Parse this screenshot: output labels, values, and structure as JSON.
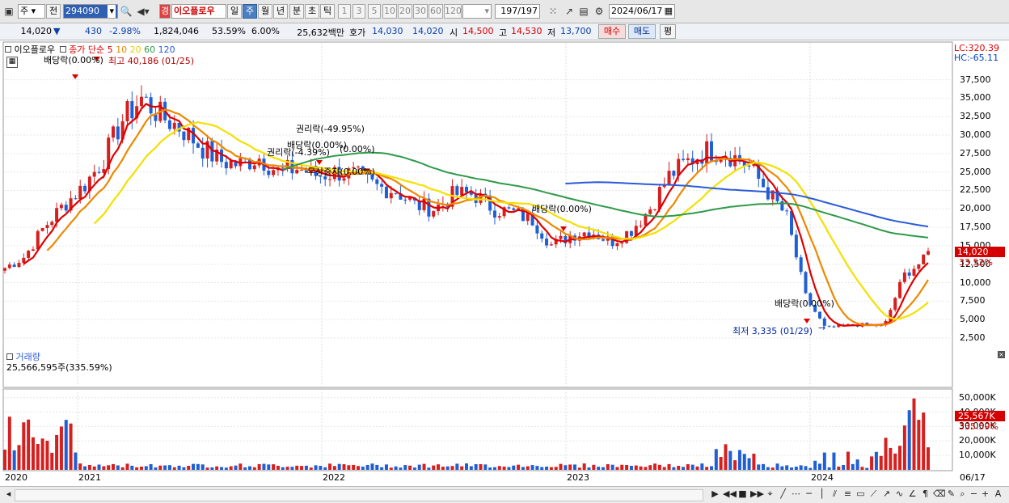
{
  "toolbar": {
    "period_short": "주",
    "prev_label": "전",
    "code": "294090",
    "stock_name": "이오플로우",
    "period_badge": "경",
    "periods": [
      "일",
      "주",
      "월",
      "년",
      "분",
      "초",
      "틱"
    ],
    "active_period": "주",
    "intervals": [
      "1",
      "3",
      "5",
      "10",
      "20",
      "30",
      "60",
      "120"
    ],
    "count": "197/197",
    "date": "2024/06/17"
  },
  "quote": {
    "price": "14,020",
    "change_arrow": "▼",
    "change": "430",
    "change_pct": "-2.98%",
    "volume": "1,824,046",
    "vol_ratio": "53.59%",
    "turnover": "6.00%",
    "amount": "25,632백만",
    "bid_label": "호가",
    "ask": "14,030",
    "bid": "14,020",
    "open_label": "시",
    "open": "14,500",
    "high_label": "고",
    "high": "14,530",
    "low_label": "저",
    "low": "13,700",
    "buy_btn": "매수",
    "sell_btn": "매도",
    "eval_btn": "평"
  },
  "legend": {
    "name": "이오플로우",
    "ma_label": "종가 단순",
    "ma_periods": [
      "5",
      "10",
      "20",
      "60",
      "120"
    ],
    "ma_colors": [
      "#dd0000",
      "#ee8800",
      "#f4e000",
      "#2f9a4a",
      "#2a5bd8"
    ]
  },
  "scale_info": {
    "lc": "LC:320.39",
    "hc": "HC:-65.11"
  },
  "price_axis": [
    "37,500",
    "35,000",
    "32,500",
    "30,000",
    "27,500",
    "25,000",
    "22,500",
    "20,000",
    "17,500",
    "15,000",
    "12,500",
    "10,000",
    "7,500",
    "5,000",
    "2,500"
  ],
  "price_tag": {
    "price": "14,020",
    "pct": "33.52%"
  },
  "annotations": {
    "high": "최고 40,186 (01/25)",
    "low": "최저 3,335 (01/29)",
    "div1": "배당락(0.00%)",
    "rights": "권리락(-49.95%)",
    "div2": "배당락(0.00%)",
    "rights2": "권리락(-4.39%)",
    "div2b": "(0.00%)",
    "free_inc": "무상증자(0.00%)",
    "div3": "배당락(0.00%)",
    "div4": "배당락(0.00%)"
  },
  "volume": {
    "title": "거래량",
    "current": "25,566,595주(335.59%)",
    "axis": [
      "50,000K",
      "40,000K",
      "30,000K",
      "20,000K",
      "10,000K"
    ],
    "tag_value": "25,567K",
    "tag_pct": "335.59%"
  },
  "x_axis": [
    "2020",
    "2021",
    "2022",
    "2023",
    "2024",
    "06/17"
  ],
  "chart_data": {
    "type": "candlestick",
    "ylim": [
      2500,
      38000
    ],
    "x": [
      "2020",
      "2021",
      "2022",
      "2023",
      "2024"
    ],
    "close_series_approx": [
      [
        0.0,
        12000
      ],
      [
        0.02,
        13500
      ],
      [
        0.04,
        17500
      ],
      [
        0.06,
        20500
      ],
      [
        0.08,
        23000
      ],
      [
        0.1,
        26500
      ],
      [
        0.12,
        32000
      ],
      [
        0.14,
        35000
      ],
      [
        0.16,
        32500
      ],
      [
        0.18,
        31000
      ],
      [
        0.2,
        28500
      ],
      [
        0.22,
        26500
      ],
      [
        0.24,
        26000
      ],
      [
        0.26,
        27000
      ],
      [
        0.28,
        25000
      ],
      [
        0.3,
        25500
      ],
      [
        0.32,
        24500
      ],
      [
        0.34,
        25000
      ],
      [
        0.36,
        24500
      ],
      [
        0.38,
        23000
      ],
      [
        0.4,
        22500
      ],
      [
        0.42,
        20500
      ],
      [
        0.44,
        20000
      ],
      [
        0.46,
        22000
      ],
      [
        0.48,
        22000
      ],
      [
        0.5,
        20000
      ],
      [
        0.52,
        19500
      ],
      [
        0.54,
        18500
      ],
      [
        0.56,
        15000
      ],
      [
        0.58,
        16500
      ],
      [
        0.6,
        17000
      ],
      [
        0.62,
        15500
      ],
      [
        0.64,
        17000
      ],
      [
        0.66,
        20000
      ],
      [
        0.68,
        24500
      ],
      [
        0.7,
        26500
      ],
      [
        0.72,
        28000
      ],
      [
        0.74,
        27500
      ],
      [
        0.76,
        26000
      ],
      [
        0.78,
        22500
      ],
      [
        0.8,
        19000
      ],
      [
        0.82,
        8000
      ],
      [
        0.84,
        3800
      ],
      [
        0.86,
        4200
      ],
      [
        0.88,
        4300
      ],
      [
        0.9,
        4100
      ],
      [
        0.92,
        11000
      ],
      [
        0.94,
        13000
      ],
      [
        0.945,
        14020
      ]
    ]
  }
}
